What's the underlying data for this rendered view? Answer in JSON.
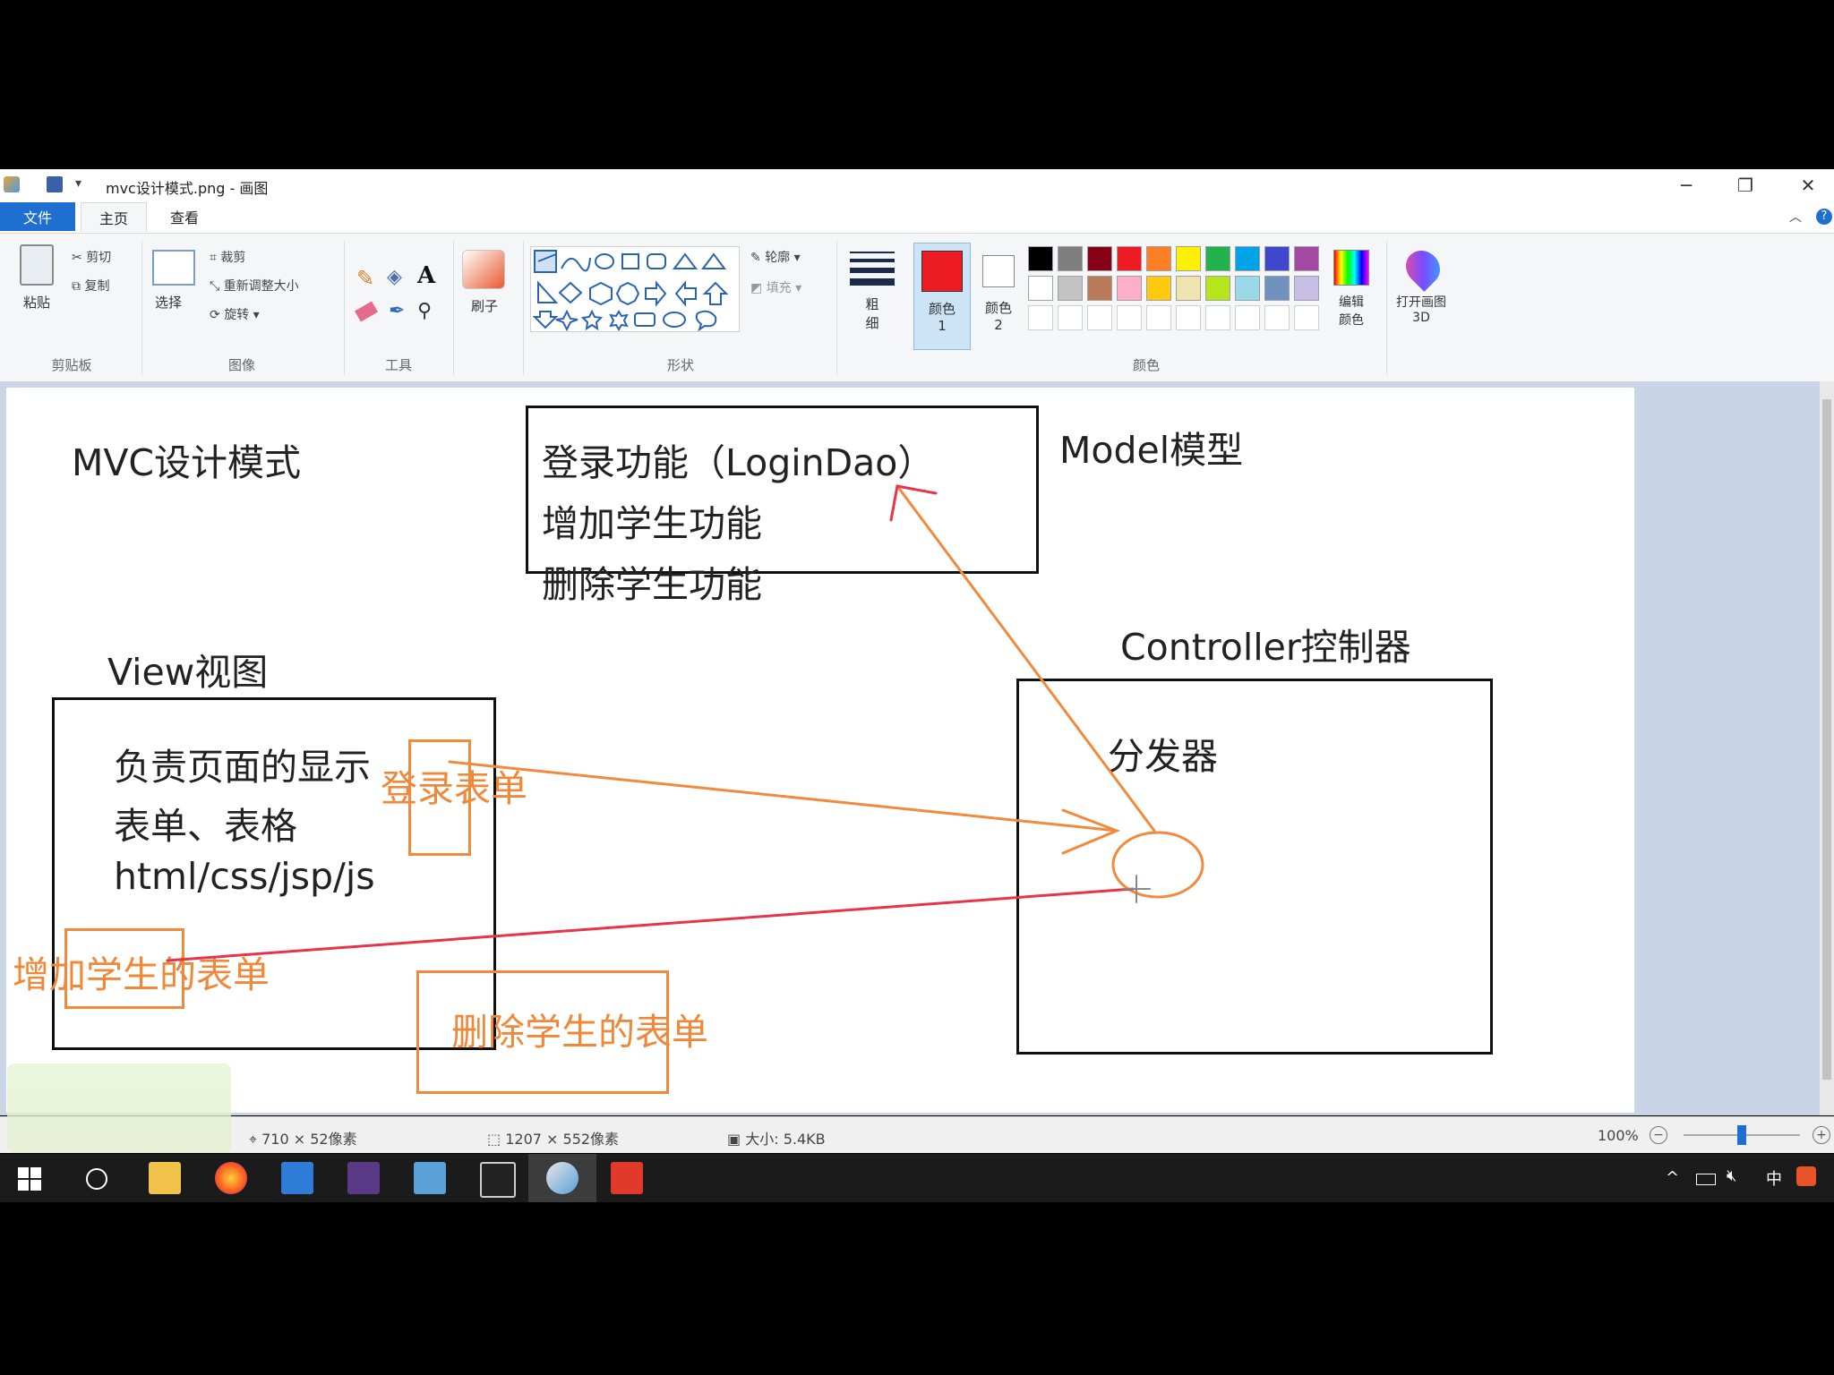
{
  "titlebar": {
    "title": "mvc设计模式.png - 画图",
    "minimize": "─",
    "restore": "❐",
    "close": "✕"
  },
  "tabs": {
    "file": "文件",
    "home": "主页",
    "view": "查看"
  },
  "ribbon": {
    "clipboard": {
      "paste": "粘贴",
      "cut": "剪切",
      "copy": "复制",
      "label": "剪贴板"
    },
    "image": {
      "select": "选择",
      "crop": "裁剪",
      "resize": "重新调整大小",
      "rotate": "旋转",
      "label": "图像"
    },
    "tools": {
      "label": "工具"
    },
    "brushes": {
      "label": "刷子"
    },
    "shapes": {
      "outline": "轮廓",
      "fill": "填充",
      "label": "形状"
    },
    "size": {
      "label": "粗细"
    },
    "color1": {
      "label": "颜色 1"
    },
    "color2": {
      "label": "颜色 2"
    },
    "colors": {
      "label": "颜色"
    },
    "edit_colors": {
      "label": "编辑颜色"
    },
    "paint3d": {
      "label": "打开画图 3D"
    },
    "palette_row1": [
      "#000000",
      "#7f7f7f",
      "#880015",
      "#ed1c24",
      "#ff7f27",
      "#fff200",
      "#22b14c",
      "#00a2e8",
      "#3f48cc",
      "#a349a4"
    ],
    "palette_row2": [
      "#ffffff",
      "#c3c3c3",
      "#b97a57",
      "#ffaec9",
      "#ffc90e",
      "#efe4b0",
      "#b5e61d",
      "#99d9ea",
      "#7092be",
      "#c8bfe7"
    ],
    "color1_value": "#ed1c24",
    "color2_value": "#ffffff"
  },
  "canvas": {
    "title": "MVC设计模式",
    "model_label": "Model模型",
    "model_lines": [
      "登录功能（LoginDao）",
      "增加学生功能",
      "删除学生功能"
    ],
    "controller_label": "Controller控制器",
    "dispatcher": "分发器",
    "view_label": "View视图",
    "view_lines": [
      "负责页面的显示",
      "表单、表格",
      "html/css/jsp/js"
    ],
    "login_form": "登录表单",
    "add_form": "增加学生的表单",
    "delete_form": "删除学生的表单"
  },
  "status": {
    "cursor": "710 × 52像素",
    "image_size": "1207 × 552像素",
    "file_size": "大小: 5.4KB",
    "zoom": "100%"
  },
  "taskbar": {
    "tray_lang": "中"
  }
}
